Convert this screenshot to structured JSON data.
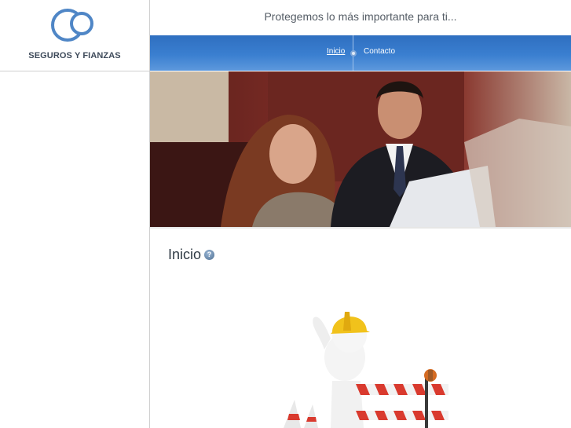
{
  "brand": {
    "name": "SEGUROS Y FIANZAS"
  },
  "header": {
    "tagline": "Protegemos lo más importante para ti..."
  },
  "nav": {
    "items": [
      {
        "label": "Inicio",
        "active": true
      },
      {
        "label": "Contacto",
        "active": false
      }
    ]
  },
  "content": {
    "title": "Inicio",
    "help_icon": "question-icon"
  },
  "colors": {
    "nav_blue": "#3a7fd0",
    "logo_blue": "#4f86c6",
    "brand_text": "#3e4a5a"
  }
}
